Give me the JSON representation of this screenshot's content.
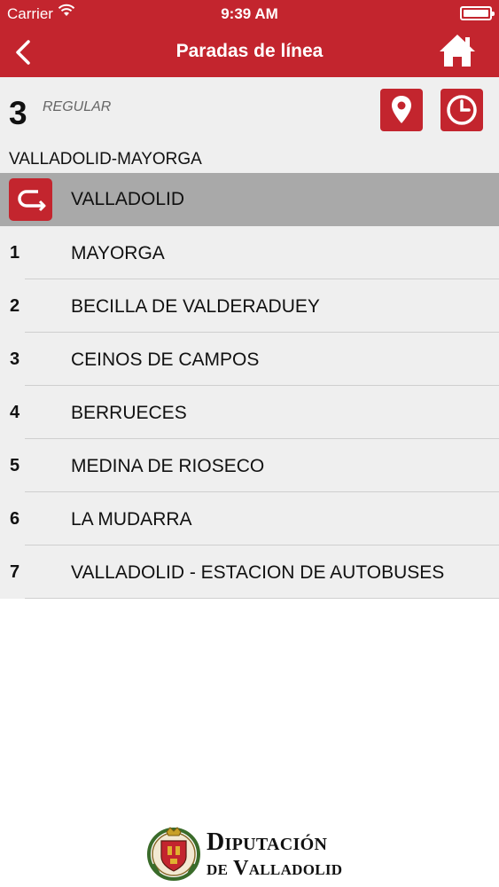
{
  "status_bar": {
    "carrier": "Carrier",
    "time": "9:39 AM"
  },
  "nav": {
    "title": "Paradas de línea",
    "back_icon": "chevron-left-icon",
    "home_icon": "home-icon"
  },
  "line": {
    "number": "3",
    "type": "REGULAR",
    "route": "VALLADOLID-MAYORGA",
    "map_icon": "map-pin-icon",
    "schedule_icon": "clock-icon"
  },
  "origin": {
    "name": "VALLADOLID",
    "icon": "return-route-icon"
  },
  "stops": [
    {
      "num": "1",
      "name": "MAYORGA"
    },
    {
      "num": "2",
      "name": "BECILLA DE VALDERADUEY"
    },
    {
      "num": "3",
      "name": "CEINOS DE CAMPOS"
    },
    {
      "num": "4",
      "name": "BERRUECES"
    },
    {
      "num": "5",
      "name": "MEDINA DE RIOSECO"
    },
    {
      "num": "6",
      "name": "LA MUDARRA"
    },
    {
      "num": "7",
      "name": "VALLADOLID - ESTACION DE AUTOBUSES"
    }
  ],
  "footer": {
    "logo_line1": "Diputación",
    "logo_line2": "de Valladolid"
  },
  "colors": {
    "brand": "#c3252e",
    "list_bg": "#efefef",
    "selected_bg": "#a9a9a9"
  }
}
